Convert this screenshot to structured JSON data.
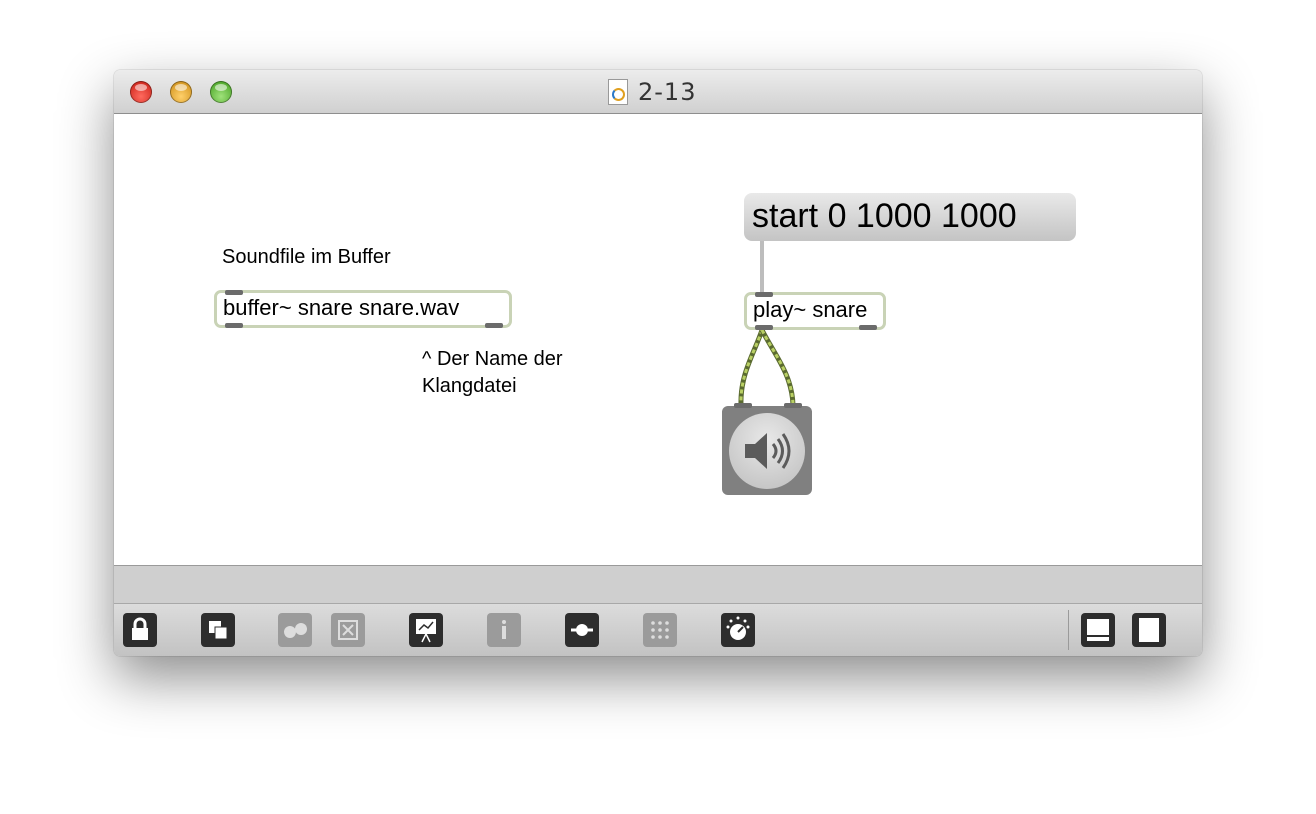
{
  "window": {
    "title": "2-13"
  },
  "patch": {
    "comment_soundfile": "Soundfile im Buffer",
    "buffer_object": "buffer~ snare snare.wav",
    "comment_name": "^ Der Name der\nKlangdatei",
    "message_box": "start 0 1000 1000",
    "play_object": "play~ snare"
  },
  "icons": {
    "dac": "speaker-icon",
    "toolbar": [
      "lock-icon",
      "new-object-icon",
      "find-icon",
      "clear-icon",
      "presentation-icon",
      "inspector-icon",
      "slider-icon",
      "grid-icon",
      "dial-icon",
      "bottom-panel-icon",
      "sidebar-panel-icon"
    ]
  },
  "colors": {
    "object_border": "#c9d3b6",
    "signal_cable": "#a6c05a",
    "message_fill": "#d4d4d4"
  }
}
